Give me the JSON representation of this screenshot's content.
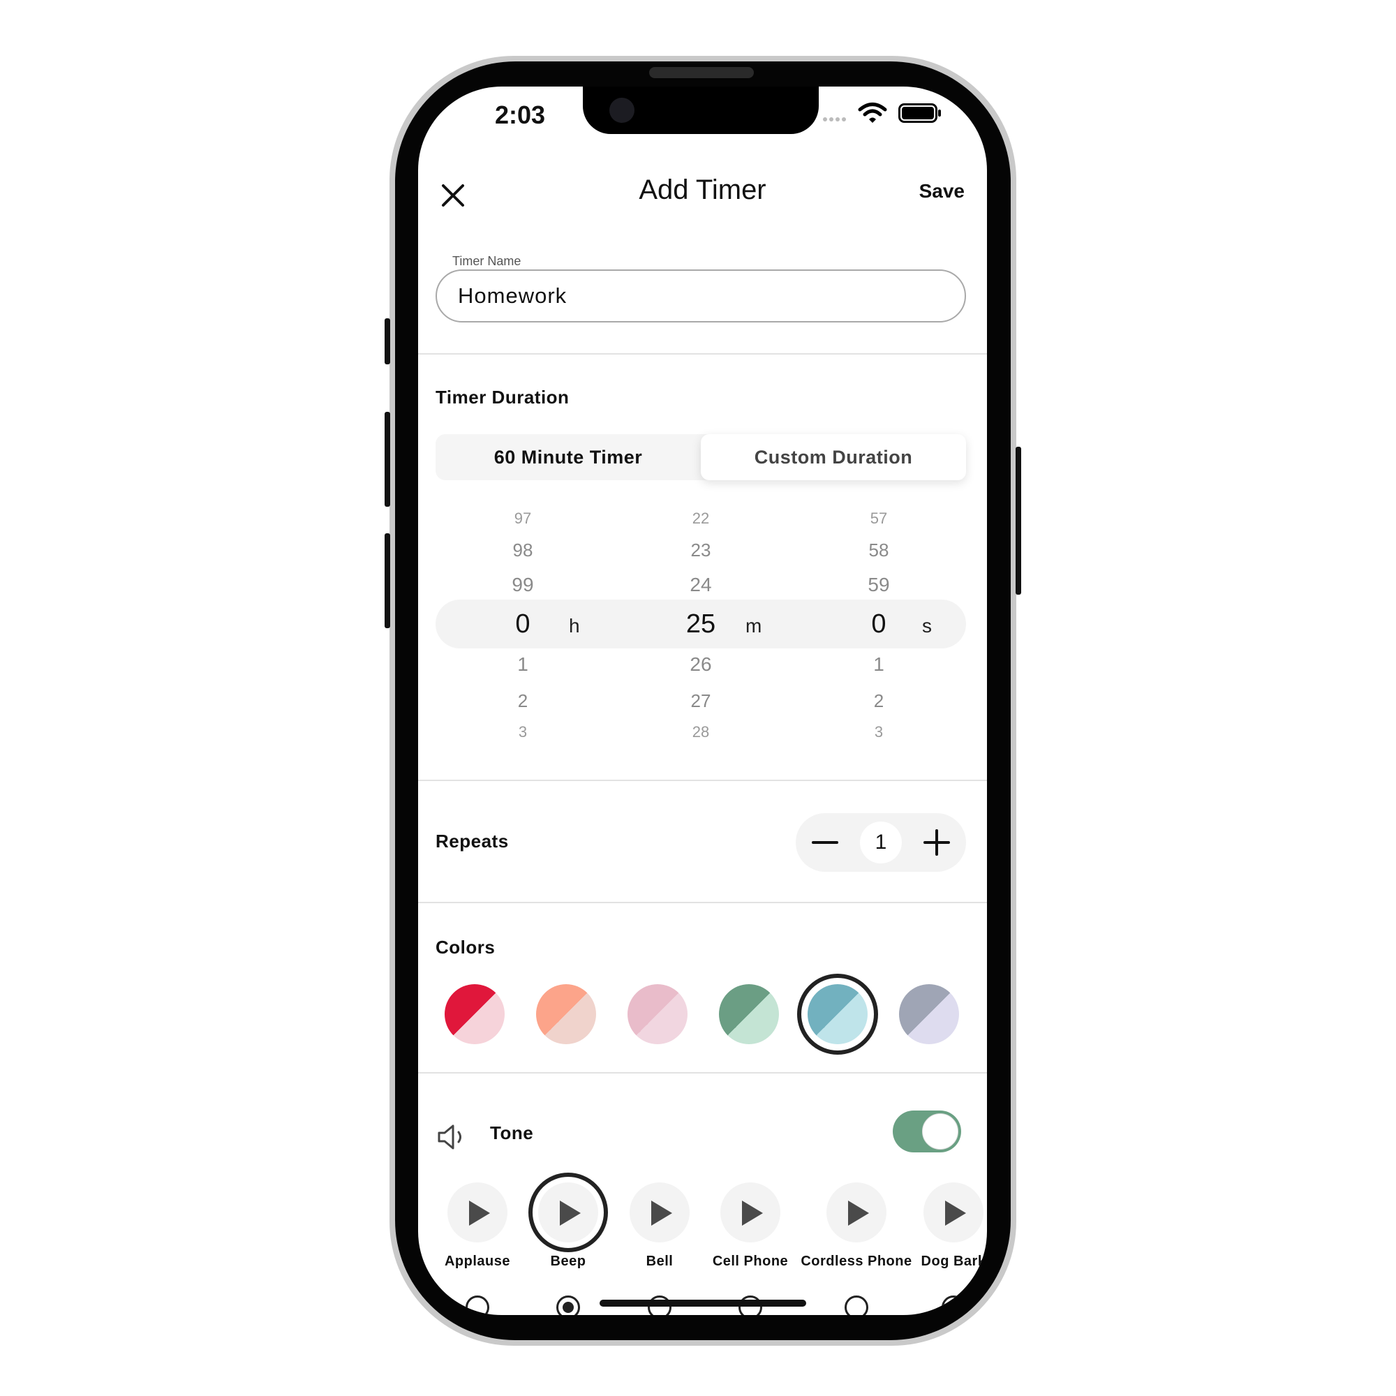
{
  "status_bar": {
    "time": "2:03"
  },
  "header": {
    "title": "Add Timer",
    "save_label": "Save"
  },
  "timer_name": {
    "label": "Timer Name",
    "value": "Homework"
  },
  "duration": {
    "section_label": "Timer Duration",
    "segments": [
      "60 Minute Timer",
      "Custom Duration"
    ],
    "selected_segment": "Custom Duration",
    "hours": {
      "above": [
        "97",
        "98",
        "99"
      ],
      "selected": "0",
      "below": [
        "1",
        "2",
        "3"
      ],
      "unit": "h"
    },
    "minutes": {
      "above": [
        "22",
        "23",
        "24"
      ],
      "selected": "25",
      "below": [
        "26",
        "27",
        "28"
      ],
      "unit": "m"
    },
    "seconds": {
      "above": [
        "57",
        "58",
        "59"
      ],
      "selected": "0",
      "below": [
        "1",
        "2",
        "3"
      ],
      "unit": "s"
    }
  },
  "repeats": {
    "label": "Repeats",
    "value": "1",
    "minus": "—",
    "plus": "+"
  },
  "colors": {
    "label": "Colors",
    "selected_index": 4,
    "swatches": [
      {
        "dark": "#e0173b",
        "light": "#f6d3da"
      },
      {
        "dark": "#fca48a",
        "light": "#f0d3cc"
      },
      {
        "dark": "#e9bcca",
        "light": "#f1d6e0"
      },
      {
        "dark": "#6b9e84",
        "light": "#c4e4d4"
      },
      {
        "dark": "#72b1bf",
        "light": "#bfe4ea"
      },
      {
        "dark": "#9fa5b5",
        "light": "#dedcef"
      }
    ]
  },
  "tone": {
    "label": "Tone",
    "enabled": true,
    "selected_index": 1,
    "options": [
      "Applause",
      "Beep",
      "Bell",
      "Cell Phone",
      "Cordless Phone",
      "Dog Bark"
    ]
  },
  "accent_color": "#6aa083"
}
